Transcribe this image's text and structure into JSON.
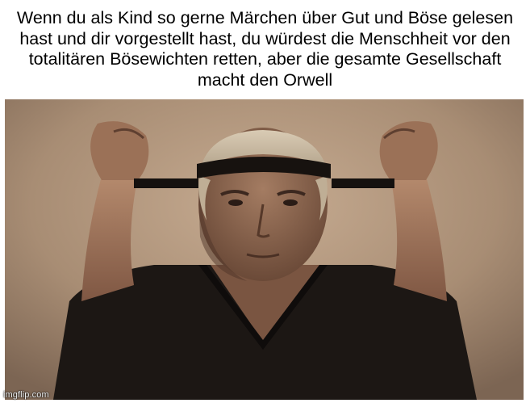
{
  "meme": {
    "caption": "Wenn du als Kind so gerne Märchen über Gut und Böse gelesen hast und dir vorgestellt hast, du würdest die Menschheit vor den totalitären Bösewichten retten, aber die gesamte Gesellschaft macht den Orwell",
    "watermark": "imgflip.com"
  },
  "colors": {
    "background": "#ffffff",
    "caption_text": "#000000",
    "photo_backdrop": "#a88d74",
    "gi_black": "#191513",
    "skin": "#9a6f55"
  }
}
